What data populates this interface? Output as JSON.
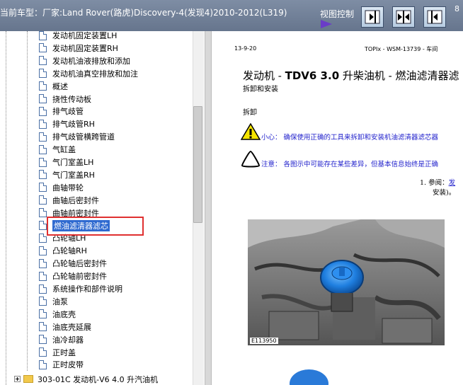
{
  "header": {
    "vehicle_label": "当前车型：厂家:Land Rover(路虎)Discovery-4(发现4)2010-2012(L319)",
    "view_control_label": "视图控制",
    "right_cut": "8",
    "buttons": [
      {
        "name": "show-right-pane",
        "icon": "pane-arrow-right-icon"
      },
      {
        "name": "show-both-panes",
        "icon": "pane-split-icon"
      },
      {
        "name": "show-left-pane",
        "icon": "pane-arrow-left-icon"
      }
    ],
    "accent": "#6a3cc8"
  },
  "tree": {
    "items": [
      "发动机固定装置LH",
      "发动机固定装置RH",
      "发动机油液排放和添加",
      "发动机油真空排放和加注",
      "概述",
      "挠性传动板",
      "排气歧管",
      "排气歧管RH",
      "排气歧管横跨管道",
      "气缸盖",
      "气门室盖LH",
      "气门室盖RH",
      "曲轴带轮",
      "曲轴后密封件",
      "曲轴前密封件",
      "燃油滤清器滤芯",
      "凸轮轴LH",
      "凸轮轴RH",
      "凸轮轴后密封件",
      "凸轮轴前密封件",
      "系统操作和部件说明",
      "油泵",
      "油底壳",
      "油底壳延展",
      "油冷却器",
      "正时盖",
      "正时皮带"
    ],
    "selected_index": 15,
    "folder_label": "303-01C 发动机-V6 4.0 升汽油机",
    "selection_color": "#2f6ad0",
    "highlight_color": "#e03030"
  },
  "document": {
    "header_left": "13-9-20",
    "header_right": "TOPIx - WSM-13739 - 车间",
    "title_prefix": "发动机 - ",
    "title_bold": "TDV6 3.0",
    "title_suffix": " 升柴油机 - 燃油滤清器滤",
    "subtitle": "拆卸和安装",
    "section": "拆卸",
    "caution": "小心：  确保使用正确的工具来拆卸和安装机油滤清器滤芯器",
    "note": "注意：  各图示中可能存在某些差异，但基本信息始终是正确",
    "step1_prefix": "1.  参阅：",
    "step1_link": "发",
    "step1_line2": "安装)。",
    "photo_caption": "E113950",
    "link_color": "#2222cc"
  }
}
